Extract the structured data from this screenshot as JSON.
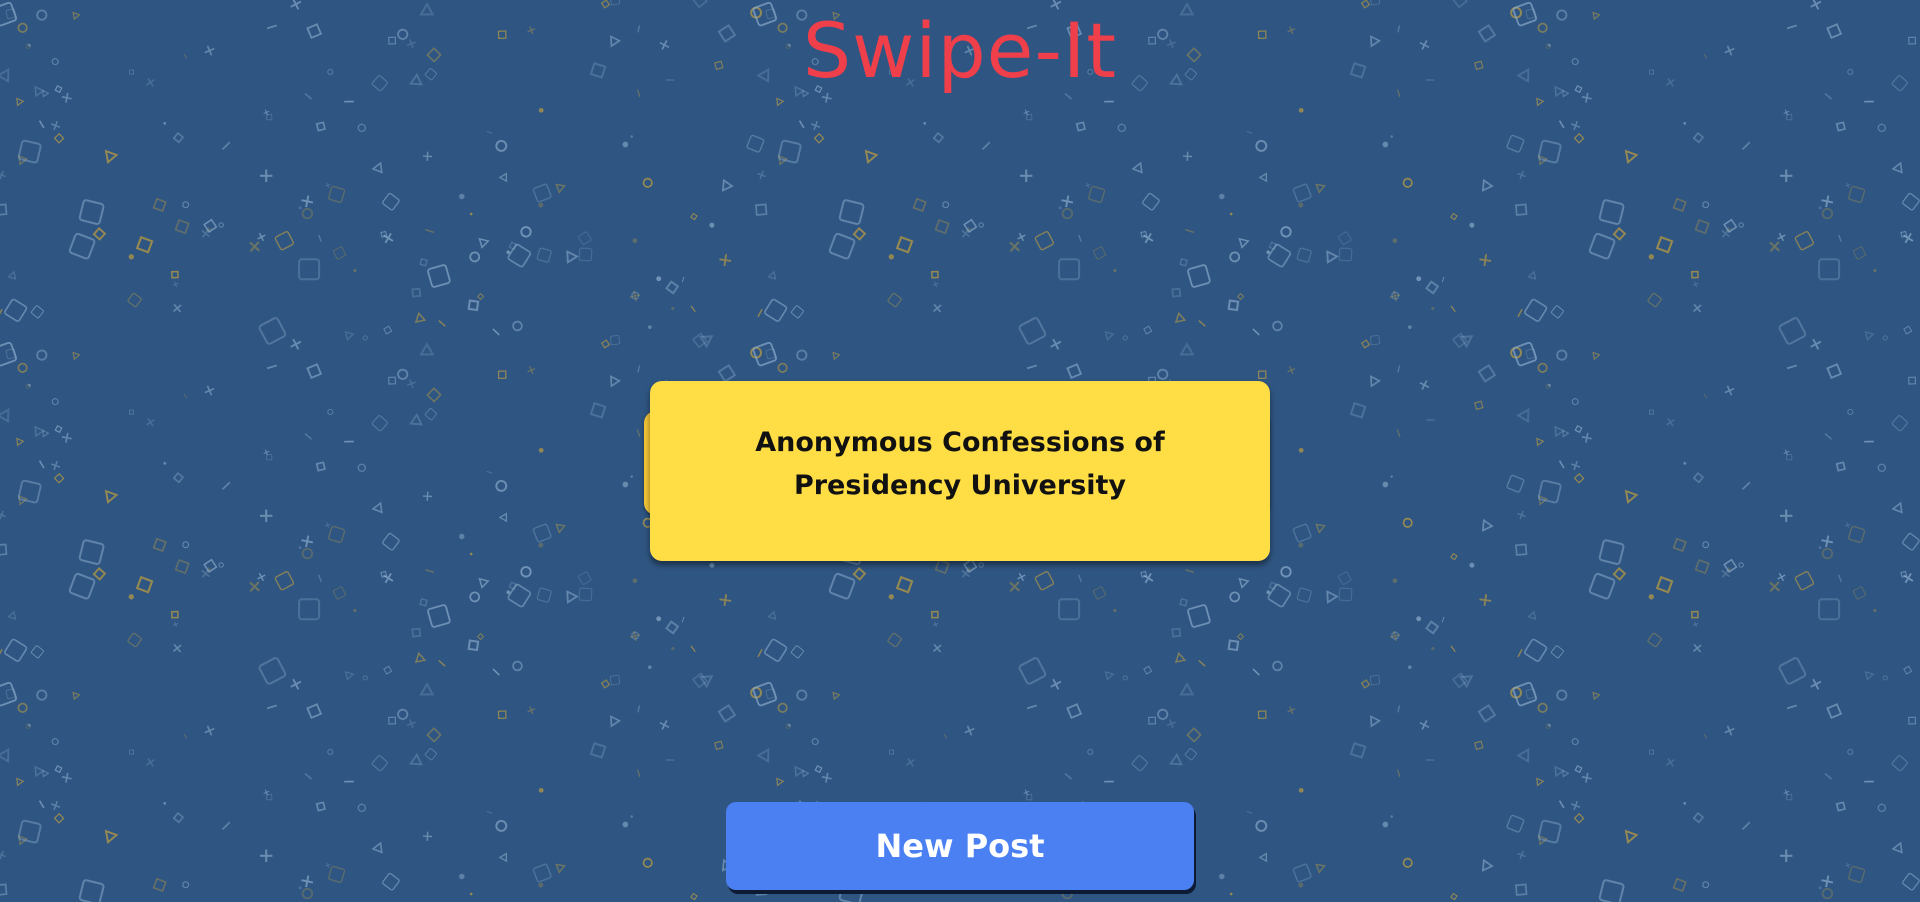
{
  "app": {
    "title": "Swipe-It"
  },
  "card": {
    "text": "Anonymous Confessions of Presidency University"
  },
  "actions": {
    "new_post_label": "New Post"
  },
  "colors": {
    "background": "#2f5582",
    "title": "#ee3f4b",
    "card": "#ffde45",
    "card_back": "#f2c435",
    "button": "#4a80f1",
    "button_text": "#ffffff",
    "pattern_light": "#8fb0cf",
    "pattern_gold": "#c9a43a"
  }
}
